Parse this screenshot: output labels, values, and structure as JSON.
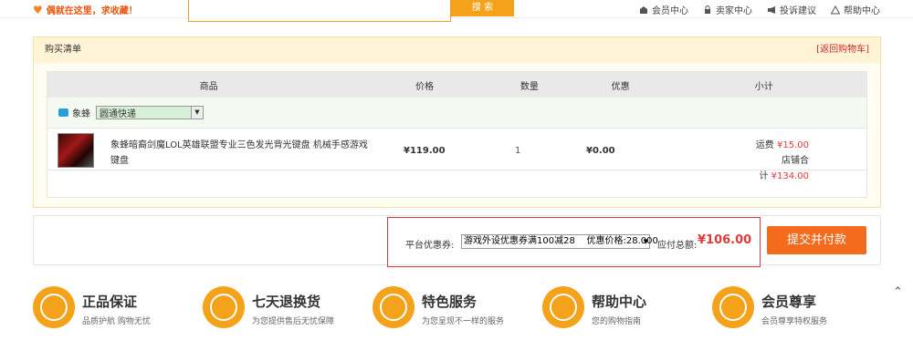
{
  "topbar": {
    "favorite_text": "偶就在这里，求收藏！",
    "search_button": "搜 索",
    "links": [
      "会员中心",
      "卖家中心",
      "投诉建议",
      "帮助中心"
    ]
  },
  "purchase": {
    "title": "购买清单",
    "back_link": "[返回购物车]",
    "columns": [
      "商品",
      "价格",
      "数量",
      "优惠",
      "小计"
    ],
    "store_name": "象蜂",
    "shipping_option": "圆通快递",
    "item": {
      "name": "象蜂暗裔剑魔LOL英雄联盟专业三色发光背光键盘 机械手感游戏键盘",
      "price": "¥119.00",
      "quantity": "1",
      "discount": "¥0.00",
      "shipping_label": "运费",
      "shipping_value": "¥15.00",
      "store_total_label": "店铺合计",
      "store_total_value": "¥134.00"
    }
  },
  "order": {
    "coupon_label": "平台优惠券:",
    "coupon_value": "游戏外设优惠券满100减28    优惠价格:28.000",
    "pay_label": "应付总额:",
    "pay_amount": "¥106.00",
    "submit": "提交并付款"
  },
  "services": [
    {
      "title": "正品保证",
      "sub": "品质护航 购物无忧",
      "icon": "genuine-icon"
    },
    {
      "title": "七天退换货",
      "sub": "为您提供售后无忧保障",
      "icon": "return-icon"
    },
    {
      "title": "特色服务",
      "sub": "为您呈现不一样的服务",
      "icon": "feature-icon"
    },
    {
      "title": "帮助中心",
      "sub": "您的购物指南",
      "icon": "help-icon"
    },
    {
      "title": "会员尊享",
      "sub": "会员尊享特权服务",
      "icon": "member-icon"
    }
  ],
  "colors": {
    "accent": "#f5a21b",
    "price_red": "#e4393c",
    "submit": "#f36b1d"
  }
}
